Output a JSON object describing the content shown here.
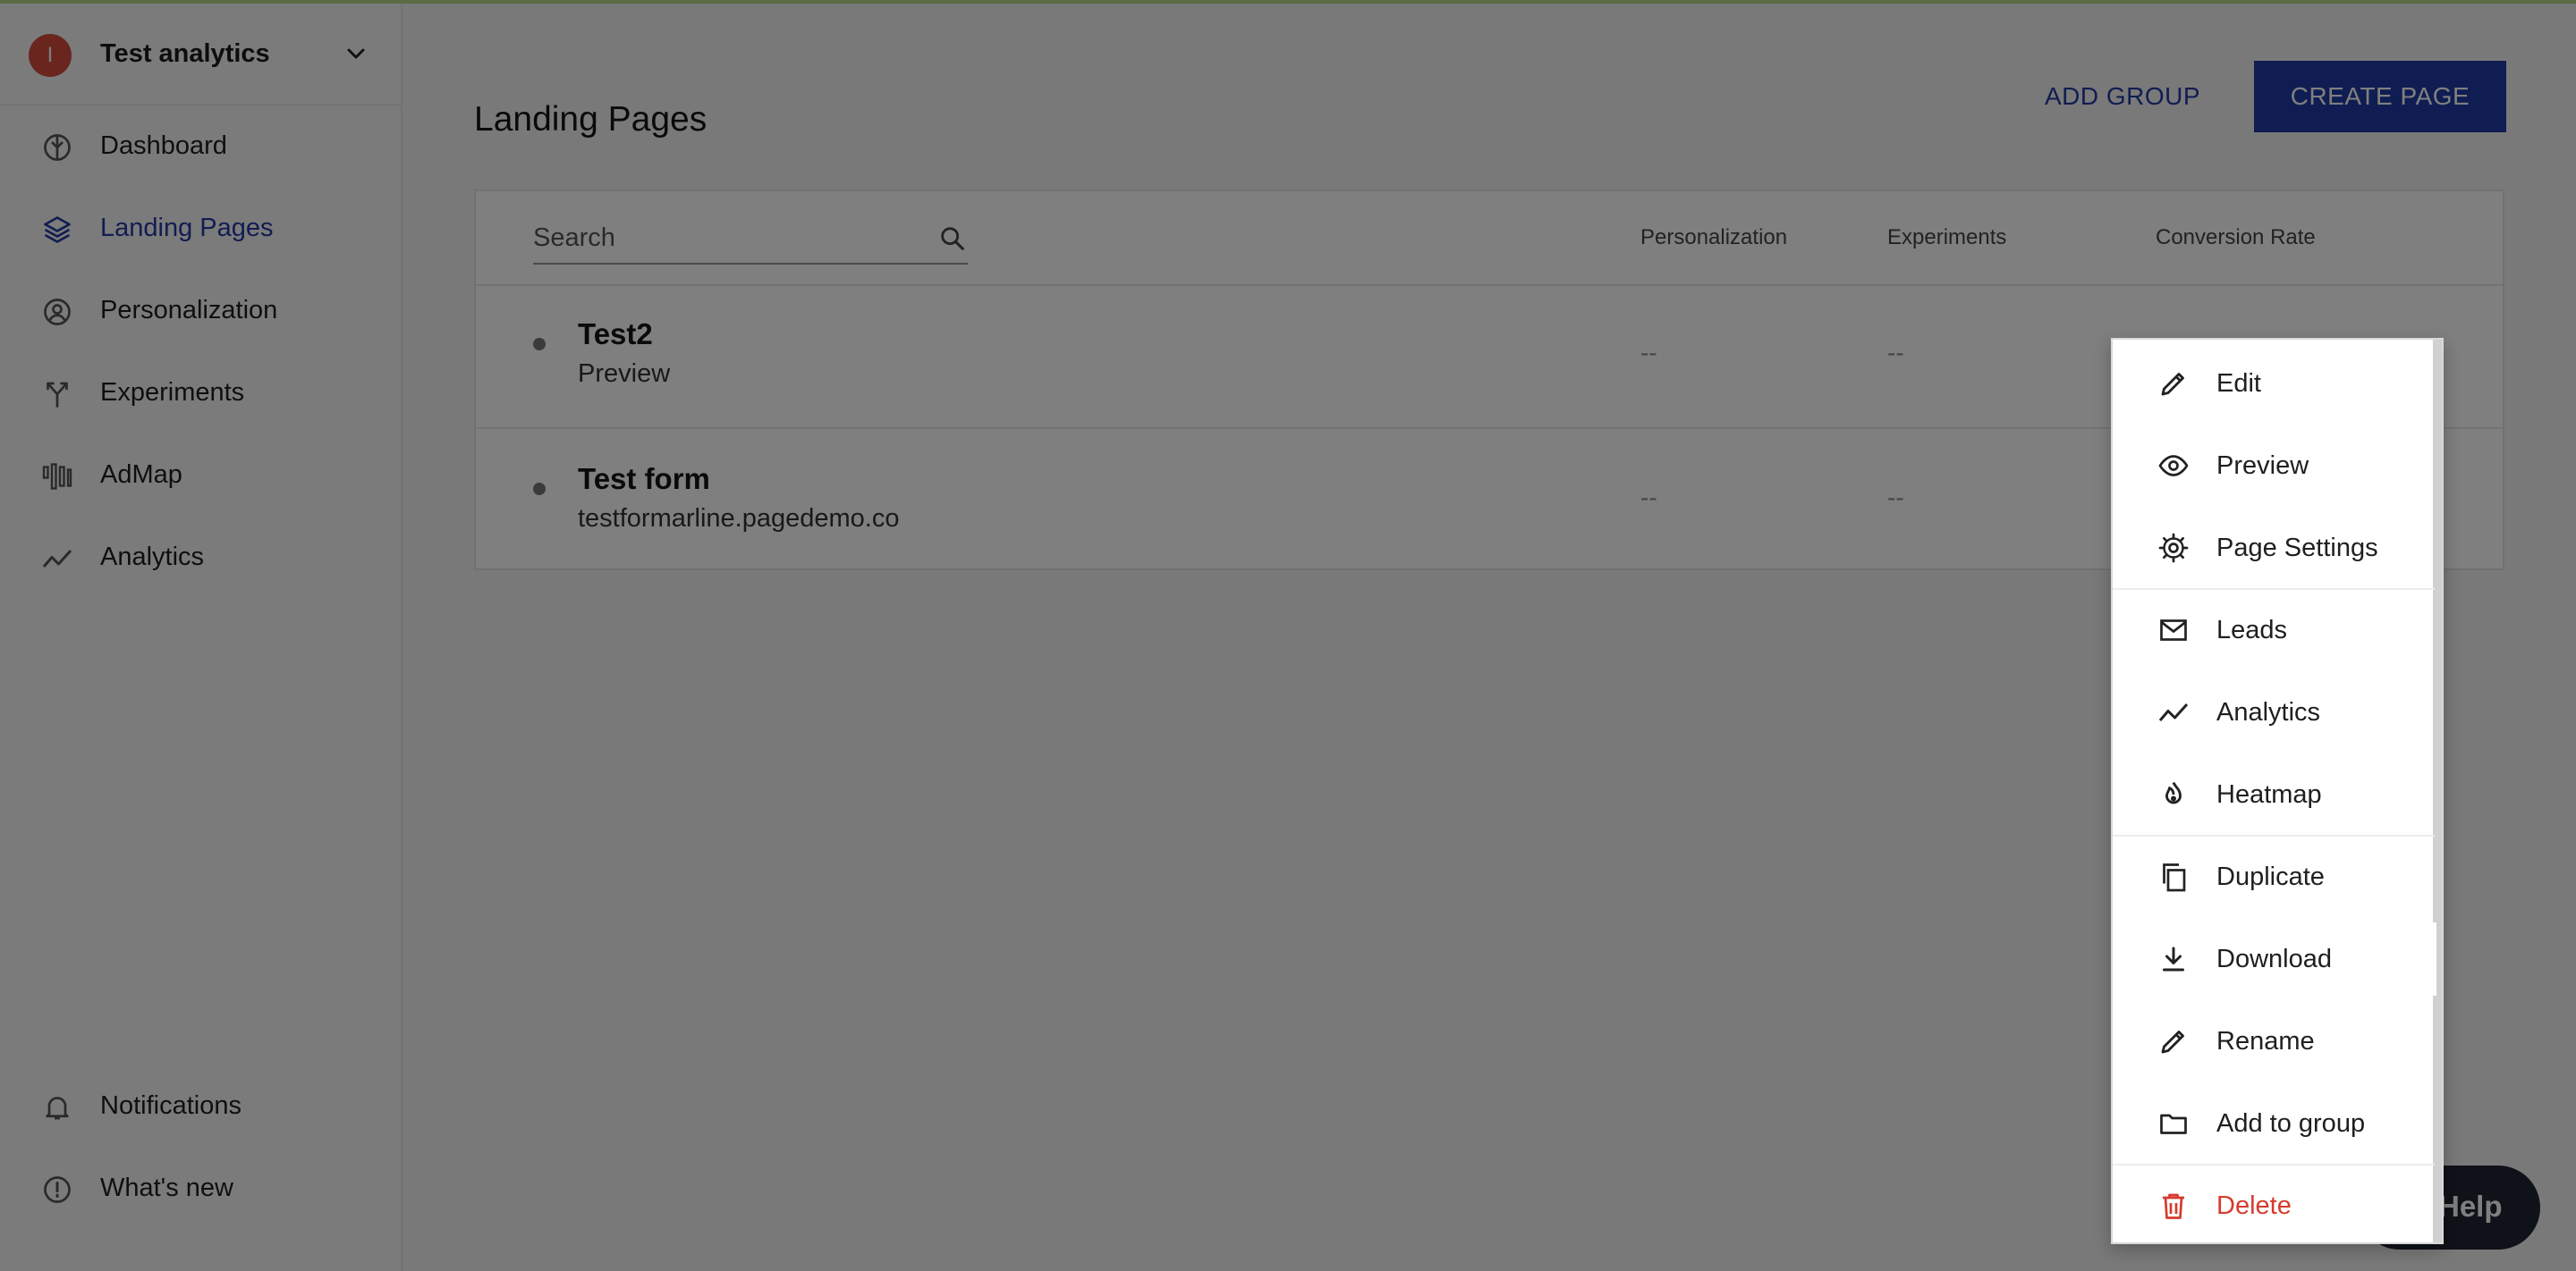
{
  "workspace": {
    "avatar_letter": "I",
    "name": "Test analytics"
  },
  "sidebar": {
    "items": [
      {
        "label": "Dashboard",
        "icon": "dashboard-icon"
      },
      {
        "label": "Landing Pages",
        "icon": "layers-icon",
        "active": true
      },
      {
        "label": "Personalization",
        "icon": "person-circle-icon"
      },
      {
        "label": "Experiments",
        "icon": "fork-icon"
      },
      {
        "label": "AdMap",
        "icon": "admap-icon"
      },
      {
        "label": "Analytics",
        "icon": "trend-icon"
      }
    ],
    "bottom": [
      {
        "label": "Notifications",
        "icon": "bell-icon"
      },
      {
        "label": "What's new",
        "icon": "info-icon"
      }
    ]
  },
  "header": {
    "title": "Landing Pages",
    "add_group": "ADD GROUP",
    "create_page": "CREATE PAGE"
  },
  "table": {
    "search_placeholder": "Search",
    "columns": [
      "Personalization",
      "Experiments",
      "Conversion Rate"
    ],
    "rows": [
      {
        "title": "Test2",
        "subtitle": "Preview",
        "personalization": "--",
        "experiments": "--"
      },
      {
        "title": "Test form",
        "subtitle": "testformarline.pagedemo.co",
        "personalization": "--",
        "experiments": "--"
      }
    ]
  },
  "menu": {
    "items": [
      {
        "label": "Edit",
        "icon": "pencil-icon"
      },
      {
        "label": "Preview",
        "icon": "eye-icon"
      },
      {
        "label": "Page Settings",
        "icon": "gear-icon"
      },
      {
        "label": "Leads",
        "icon": "mail-icon"
      },
      {
        "label": "Analytics",
        "icon": "trend-icon"
      },
      {
        "label": "Heatmap",
        "icon": "flame-icon"
      },
      {
        "label": "Duplicate",
        "icon": "copy-icon"
      },
      {
        "label": "Download",
        "icon": "download-icon",
        "highlighted": true
      },
      {
        "label": "Rename",
        "icon": "pencil-icon"
      },
      {
        "label": "Add to group",
        "icon": "folder-icon"
      },
      {
        "label": "Delete",
        "icon": "trash-icon",
        "color": "#d63a2f"
      }
    ]
  },
  "help": {
    "label": "Help"
  }
}
